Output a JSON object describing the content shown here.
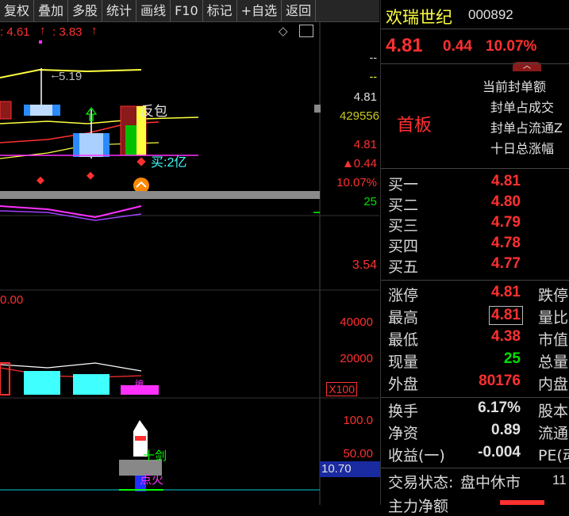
{
  "toolbar": {
    "items": [
      "复权",
      "叠加",
      "多股",
      "统计",
      "画线",
      "F10",
      "标记",
      "+自选",
      "返回"
    ]
  },
  "chart": {
    "header_left": ": 4.61",
    "header_right": ": 3.83",
    "ma_value": "5.19",
    "label_fanbao": "反包",
    "label_buy": "买:2亿",
    "axis_price": [
      "--",
      "--",
      "4.81",
      "429556",
      "4.81",
      "▲0.44",
      "10.07%",
      "25",
      "3.54"
    ],
    "axis_volume": [
      "40000",
      "20000"
    ],
    "axis_volume_unit": "X100",
    "vol_header": "0.00",
    "axis_indicator": [
      "100.0",
      "50.00"
    ],
    "indicator_value": "10.70",
    "label_shijian": "十剑",
    "label_dianhuo": "点火"
  },
  "stock": {
    "name": "欢瑞世纪",
    "code": "000892",
    "price": "4.81",
    "change": "0.44",
    "change_pct": "10.07%",
    "board_tag": "首板",
    "seal_labels": [
      "当前封单额",
      "封单占成交",
      "封单占流通Z",
      "十日总涨幅"
    ]
  },
  "order_book": [
    {
      "label": "买一",
      "price": "4.81"
    },
    {
      "label": "买二",
      "price": "4.80"
    },
    {
      "label": "买三",
      "price": "4.79"
    },
    {
      "label": "买四",
      "price": "4.78"
    },
    {
      "label": "买五",
      "price": "4.77"
    }
  ],
  "stats": [
    {
      "label": "涨停",
      "value": "4.81",
      "color": "#ff3030",
      "right": "跌停"
    },
    {
      "label": "最高",
      "value": "4.81",
      "color": "#ff3030",
      "right": "量比"
    },
    {
      "label": "最低",
      "value": "4.38",
      "color": "#ff3030",
      "right": "市值"
    },
    {
      "label": "现量",
      "value": "25",
      "color": "#00e000",
      "right": "总量"
    },
    {
      "label": "外盘",
      "value": "80176",
      "color": "#ff3030",
      "right": "内盘"
    }
  ],
  "fundamentals": [
    {
      "label": "换手",
      "value": "6.17%",
      "right": "股本"
    },
    {
      "label": "净资",
      "value": "0.89",
      "right": "流通"
    },
    {
      "label": "收益(一)",
      "value": "-0.004",
      "right": "PE(动"
    }
  ],
  "status": {
    "label": "交易状态:",
    "value": "盘中休市",
    "extra": "11",
    "bottom_label": "主力净额"
  },
  "colors": {
    "up": "#ff3030",
    "down": "#00e000",
    "ma_yellow": "#ffff40",
    "magenta": "#ff30ff",
    "cyan": "#40ffff"
  }
}
